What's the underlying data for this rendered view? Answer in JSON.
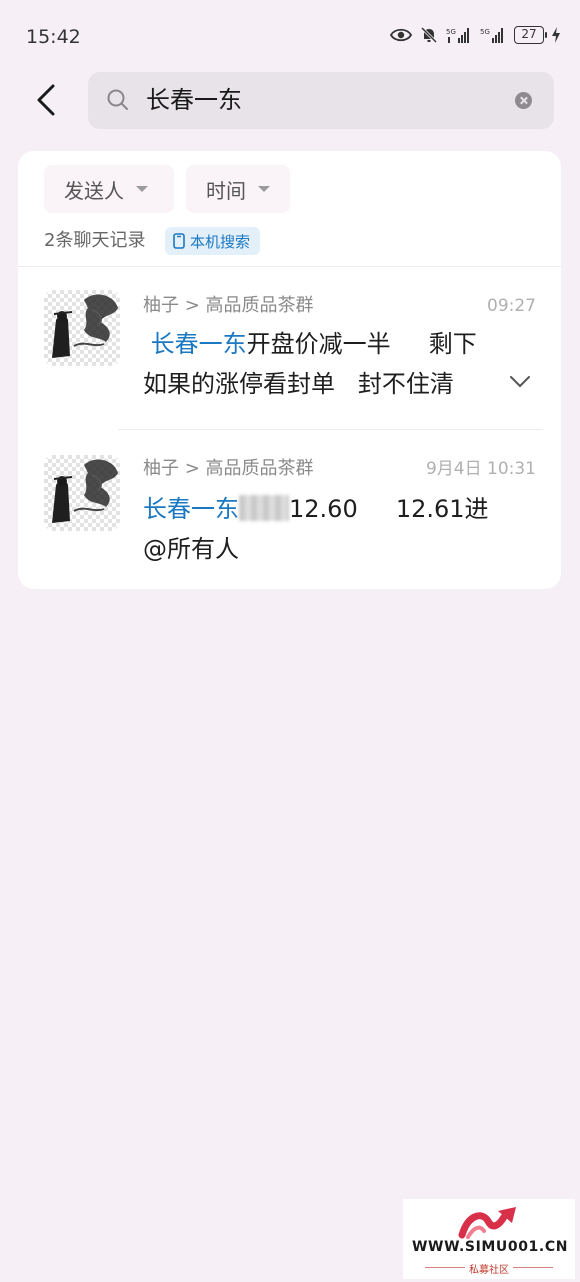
{
  "status_bar": {
    "time": "15:42",
    "battery": "27",
    "icons": [
      "eye-icon",
      "mute-bell-icon",
      "signal-5g-icon",
      "signal-5g-icon",
      "battery-icon",
      "charging-icon"
    ]
  },
  "header": {
    "back_icon": "chevron-left-icon",
    "search": {
      "value": "长春一东",
      "icon": "search-icon",
      "clear_icon": "clear-icon"
    }
  },
  "filters": {
    "sender_label": "发送人",
    "time_label": "时间"
  },
  "results": {
    "count_text": "2条聊天记录",
    "local_search_label": "本机搜索"
  },
  "messages": [
    {
      "source": "柚子 > 高品质品茶群",
      "time": "09:27",
      "highlight": "长春一东",
      "line1_rest": "开盘价减一半     剩下",
      "line2": "如果的涨停看封单   封不住清"
    },
    {
      "source": "柚子 > 高品质品茶群",
      "time": "9月4日 10:31",
      "highlight": "长春一东",
      "line1_rest": "12.60     12.61进",
      "line2": "@所有人"
    }
  ],
  "watermark": {
    "site": "WWW.SIMU001.CN",
    "subtitle": "私募社区"
  },
  "colors": {
    "background": "#f6f0f6",
    "accent": "#1b78c2",
    "card": "#ffffff"
  }
}
